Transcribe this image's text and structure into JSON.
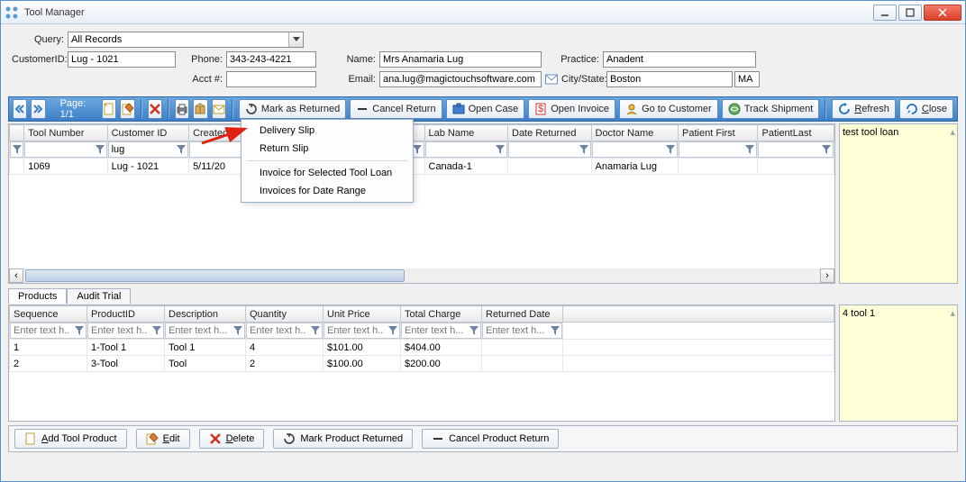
{
  "window": {
    "title": "Tool Manager"
  },
  "form": {
    "query_label": "Query:",
    "query_value": "All Records",
    "customer_id_label": "CustomerID:",
    "customer_id_value": "Lug - 1021",
    "phone_label": "Phone:",
    "phone_value": "343-243-4221",
    "name_label": "Name:",
    "name_value": "Mrs Anamaria Lug",
    "practice_label": "Practice:",
    "practice_value": "Anadent",
    "acct_label": "Acct #:",
    "acct_value": "",
    "email_label": "Email:",
    "email_value": "ana.lug@magictouchsoftware.com",
    "city_state_label": "City/State:",
    "city_value": "Boston",
    "state_value": "MA"
  },
  "toolbar": {
    "page_label": "Page: 1/1",
    "mark_returned": "Mark as Returned",
    "cancel_return": "Cancel Return",
    "open_case": "Open Case",
    "open_invoice": "Open Invoice",
    "go_to_customer": "Go to Customer",
    "track_shipment": "Track Shipment",
    "refresh": "Refresh",
    "close": "Close"
  },
  "menu": {
    "delivery_slip": "Delivery Slip",
    "return_slip": "Return Slip",
    "invoice_selected": "Invoice for Selected Tool Loan",
    "invoices_range": "Invoices for Date Range"
  },
  "upper_grid": {
    "columns": [
      "Tool Number",
      "Customer ID",
      "Created",
      "",
      "Lab Name",
      "Date Returned",
      "Doctor Name",
      "Patient First",
      "PatientLast"
    ],
    "filter_placeholder": "",
    "filter_values": [
      "",
      "lug",
      "",
      "",
      "",
      "",
      "",
      "",
      ""
    ],
    "rows": [
      {
        "tool_number": "1069",
        "customer_id": "Lug - 1021",
        "created": "5/11/20",
        "c4": "",
        "lab_name": "Canada-1",
        "date_returned": "",
        "doctor_name": "Anamaria Lug",
        "patient_first": "",
        "patient_last": ""
      }
    ],
    "note": "test tool loan"
  },
  "tabs": {
    "products": "Products",
    "audit": "Audit Trial"
  },
  "lower_grid": {
    "columns": [
      "Sequence",
      "ProductID",
      "Description",
      "Quantity",
      "Unit Price",
      "Total Charge",
      "Returned Date"
    ],
    "filter_placeholder": "Enter text h...",
    "rows": [
      {
        "sequence": "1",
        "product_id": "1-Tool 1",
        "description": "Tool 1",
        "quantity": "4",
        "unit_price": "$101.00",
        "total_charge": "$404.00",
        "returned_date": ""
      },
      {
        "sequence": "2",
        "product_id": "3-Tool",
        "description": "Tool",
        "quantity": "2",
        "unit_price": "$100.00",
        "total_charge": "$200.00",
        "returned_date": ""
      }
    ],
    "note": "4 tool 1"
  },
  "bottom_bar": {
    "add": "Add Tool Product",
    "edit": "Edit",
    "delete": "Delete",
    "mark_returned": "Mark Product Returned",
    "cancel_return": "Cancel Product Return"
  }
}
